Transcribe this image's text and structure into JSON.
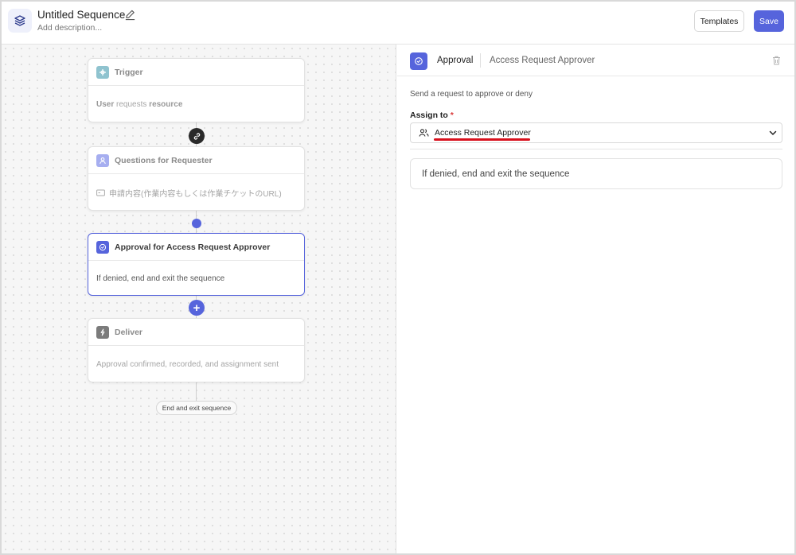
{
  "header": {
    "title": "Untitled Sequence",
    "description_placeholder": "Add description...",
    "templates_label": "Templates",
    "save_label": "Save"
  },
  "canvas": {
    "nodes": [
      {
        "title": "Trigger",
        "body_prefix": "User",
        "body_mid": " requests ",
        "body_suffix": "resource",
        "icon": "trigger-icon"
      },
      {
        "title": "Questions for Requester",
        "body": "申請内容(作業内容もしくは作業チケットのURL)",
        "icon": "person-icon"
      },
      {
        "title": "Approval for Access Request Approver",
        "body": "If denied, end and exit the sequence",
        "icon": "approval-check-icon"
      },
      {
        "title": "Deliver",
        "body": "Approval confirmed, recorded, and assignment sent",
        "icon": "lightning-icon"
      }
    ],
    "plus_label": "+",
    "end_label": "End and exit sequence"
  },
  "panel": {
    "type": "Approval",
    "name": "Access Request Approver",
    "description": "Send a request to approve or deny",
    "assign_label": "Assign to",
    "required_mark": "*",
    "assign_value": "Access Request Approver",
    "deny_text": "If denied, end and exit the sequence"
  },
  "colors": {
    "accent": "#5664dc",
    "annotation_red": "#d8101c"
  }
}
